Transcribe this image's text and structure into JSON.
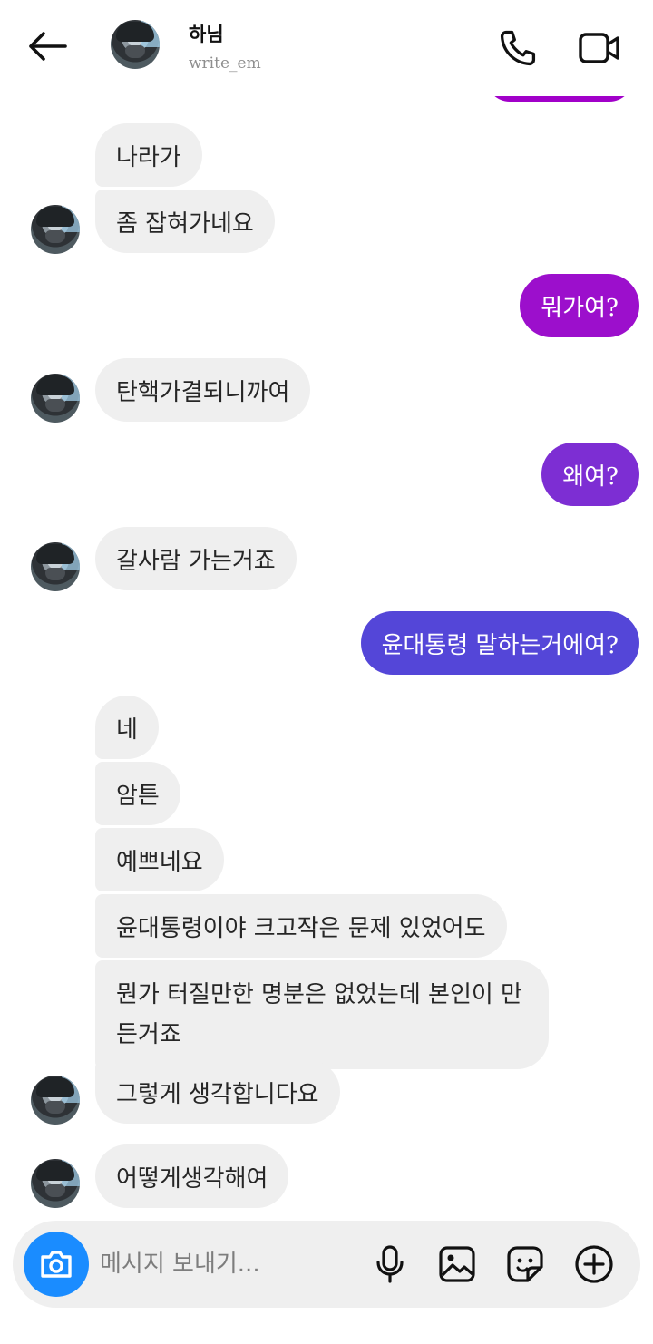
{
  "header": {
    "title": "하님",
    "username": "write_em",
    "icons": {
      "back": "arrow-left-icon",
      "call": "phone-icon",
      "video": "video-camera-icon"
    }
  },
  "colors": {
    "incoming_bubble": "#efefef",
    "outgoing_gradient_top": "#a100c9",
    "outgoing_gradient_bottom": "#4f46d8",
    "camera_button": "#1a8cff"
  },
  "messages": [
    {
      "side": "in",
      "text": "나라가"
    },
    {
      "side": "in",
      "text": "좀 잡혀가네요"
    },
    {
      "side": "out",
      "text": "뭐가여?"
    },
    {
      "side": "in",
      "text": "탄핵가결되니까여"
    },
    {
      "side": "out",
      "text": "왜여?"
    },
    {
      "side": "in",
      "text": "갈사람 가는거죠"
    },
    {
      "side": "out",
      "text": "윤대통령 말하는거에여?"
    },
    {
      "side": "in",
      "text": "네"
    },
    {
      "side": "in",
      "text": "암튼"
    },
    {
      "side": "in",
      "text": "예쁘네요"
    },
    {
      "side": "in",
      "text": "윤대통령이야 크고작은 문제 있었어도"
    },
    {
      "side": "in",
      "text": "뭔가 터질만한 명분은 없었는데 본인이 만든거죠"
    },
    {
      "side": "in",
      "text": "그렇게 생각합니다요"
    },
    {
      "side": "in",
      "text": "어떻게생각해여"
    }
  ],
  "composer": {
    "placeholder": "메시지 보내기...",
    "icons": [
      "camera-icon",
      "microphone-icon",
      "image-icon",
      "sticker-icon",
      "plus-circle-icon"
    ]
  }
}
